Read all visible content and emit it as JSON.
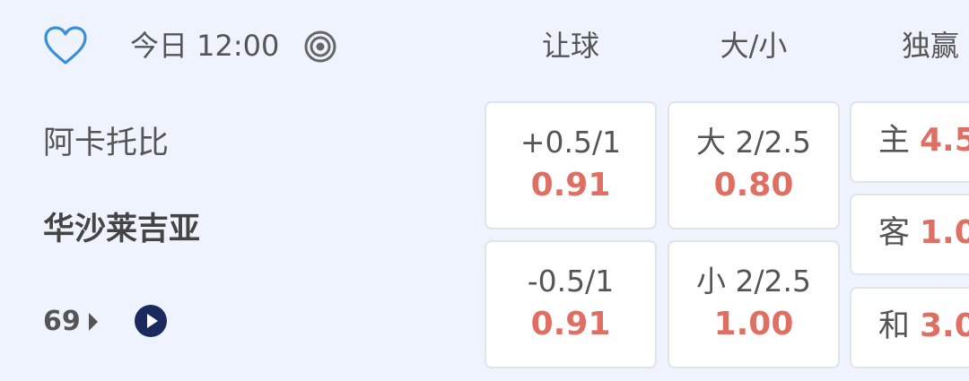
{
  "header": {
    "time": "今日 12:00",
    "columns": [
      "让球",
      "大/小",
      "独赢"
    ]
  },
  "teams": {
    "home": "阿卡托比",
    "away": "华沙莱吉亚"
  },
  "more_count": "69",
  "handicap": [
    {
      "line": "+0.5/1",
      "odds": "0.91"
    },
    {
      "line": "-0.5/1",
      "odds": "0.91"
    }
  ],
  "over_under": [
    {
      "line": "大 2/2.5",
      "odds": "0.80"
    },
    {
      "line": "小 2/2.5",
      "odds": "1.00"
    }
  ],
  "moneyline": [
    {
      "label": "主",
      "odds": "4.5"
    },
    {
      "label": "客",
      "odds": "1.0"
    },
    {
      "label": "和",
      "odds": "3.0"
    }
  ],
  "colors": {
    "background": "#eef3fd",
    "favorite": "#3a8fd8",
    "odds": "#e06f63",
    "play": "#1a2a5e"
  }
}
